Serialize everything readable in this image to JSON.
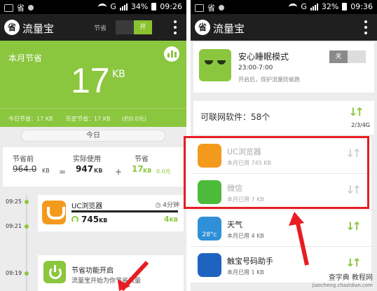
{
  "left": {
    "status": {
      "signal_label": "G",
      "battery": "34%",
      "time": "09:26"
    },
    "appbar": {
      "title": "流量宝",
      "toggle_label": "节省",
      "toggle_on": "开"
    },
    "hero": {
      "label": "本月节省",
      "value": "17",
      "unit": "KB",
      "today": "今日节省：17 KB",
      "history": "历史节省：17 KB",
      "money": "(约0.0元)"
    },
    "today_label": "今日",
    "summary": {
      "before_label": "节省前",
      "before_value": "964.0",
      "before_unit": "KB",
      "actual_label": "实际使用",
      "actual_value": "947",
      "actual_unit": "KB",
      "saved_label": "节省",
      "saved_value": "17",
      "saved_unit": "KB",
      "saved_money": "0.0元",
      "eq": "=",
      "plus": "+"
    },
    "timeline": [
      {
        "time": "09:25"
      },
      {
        "time": "09:21"
      },
      {
        "time": "09:19"
      }
    ],
    "uc_card": {
      "name": "UC浏览器",
      "duration": "4分钟",
      "used": "745",
      "used_unit": "KB",
      "saved": "4",
      "saved_unit": "KB"
    },
    "feature_card": {
      "name": "节省功能开启",
      "desc": "流量宝开始为你节省流量"
    }
  },
  "right": {
    "status": {
      "signal_label": "G",
      "battery": "32%",
      "time": "09:36"
    },
    "appbar": {
      "title": "流量宝"
    },
    "sleep": {
      "name": "安心睡眠模式",
      "time": "23:00-7:00",
      "desc": "开启后，保护流量防偷跑",
      "btn": "关"
    },
    "netcount": {
      "label": "可联网软件：58个",
      "network": "2/3/4G"
    },
    "apps": [
      {
        "name": "UC浏览器",
        "usage": "本月已用 745 KB",
        "dim": true,
        "color": "#f39a1d",
        "icon": "uc-browser-icon"
      },
      {
        "name": "微信",
        "usage": "本月已用 7 KB",
        "dim": true,
        "color": "#4cbb3a",
        "icon": "wechat-icon"
      },
      {
        "name": "天气",
        "usage": "本月已用 4 KB",
        "dim": false,
        "color": "#2f8fd8",
        "icon": "weather-icon",
        "badge": "28°c"
      },
      {
        "name": "触宝号码助手",
        "usage": "本月已用 1 KB",
        "dim": false,
        "color": "#1f63c0",
        "icon": "dialer-icon"
      }
    ]
  },
  "watermark": {
    "line1": "查字典 教程网",
    "line2": "jiaocheng.chazidian.com"
  },
  "colors": {
    "accent": "#8bc63f",
    "dark": "#1f1f1f",
    "highlight": "#e81c23"
  }
}
